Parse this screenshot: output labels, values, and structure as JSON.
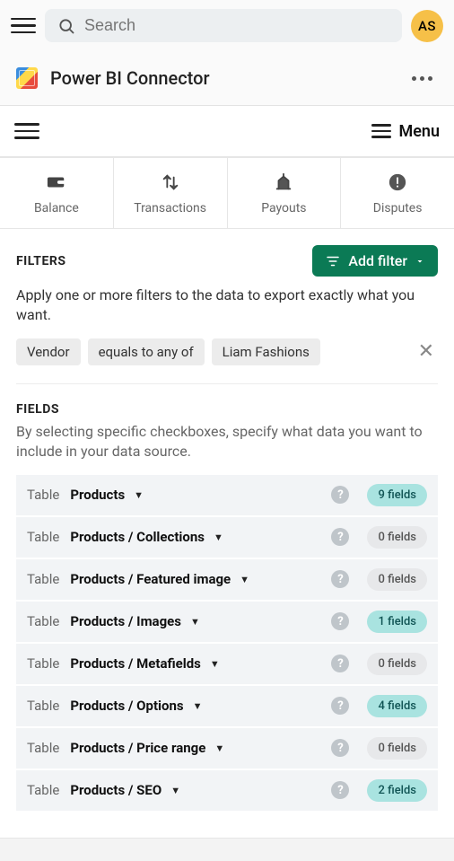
{
  "topbar": {
    "search_placeholder": "Search",
    "avatar_initials": "AS"
  },
  "app": {
    "title": "Power BI Connector"
  },
  "menu": {
    "label": "Menu"
  },
  "tabs": [
    {
      "id": "balance",
      "label": "Balance",
      "icon": "wallet"
    },
    {
      "id": "transactions",
      "label": "Transactions",
      "icon": "swap"
    },
    {
      "id": "payouts",
      "label": "Payouts",
      "icon": "payout"
    },
    {
      "id": "disputes",
      "label": "Disputes",
      "icon": "alert"
    }
  ],
  "filters": {
    "title": "FILTERS",
    "add_button": "Add filter",
    "description": "Apply one or more filters to the data to export exactly what you want.",
    "chips": [
      "Vendor",
      "equals to any of",
      "Liam Fashions"
    ]
  },
  "fields": {
    "title": "FIELDS",
    "description": "By selecting specific checkboxes, specify what data you want to include in your data source.",
    "table_prefix": "Table",
    "rows": [
      {
        "name": "Products",
        "count": 9
      },
      {
        "name": "Products / Collections",
        "count": 0
      },
      {
        "name": "Products / Featured image",
        "count": 0
      },
      {
        "name": "Products / Images",
        "count": 1
      },
      {
        "name": "Products / Metafields",
        "count": 0
      },
      {
        "name": "Products / Options",
        "count": 4
      },
      {
        "name": "Products / Price range",
        "count": 0
      },
      {
        "name": "Products / SEO",
        "count": 2
      }
    ],
    "fields_suffix": "fields"
  }
}
